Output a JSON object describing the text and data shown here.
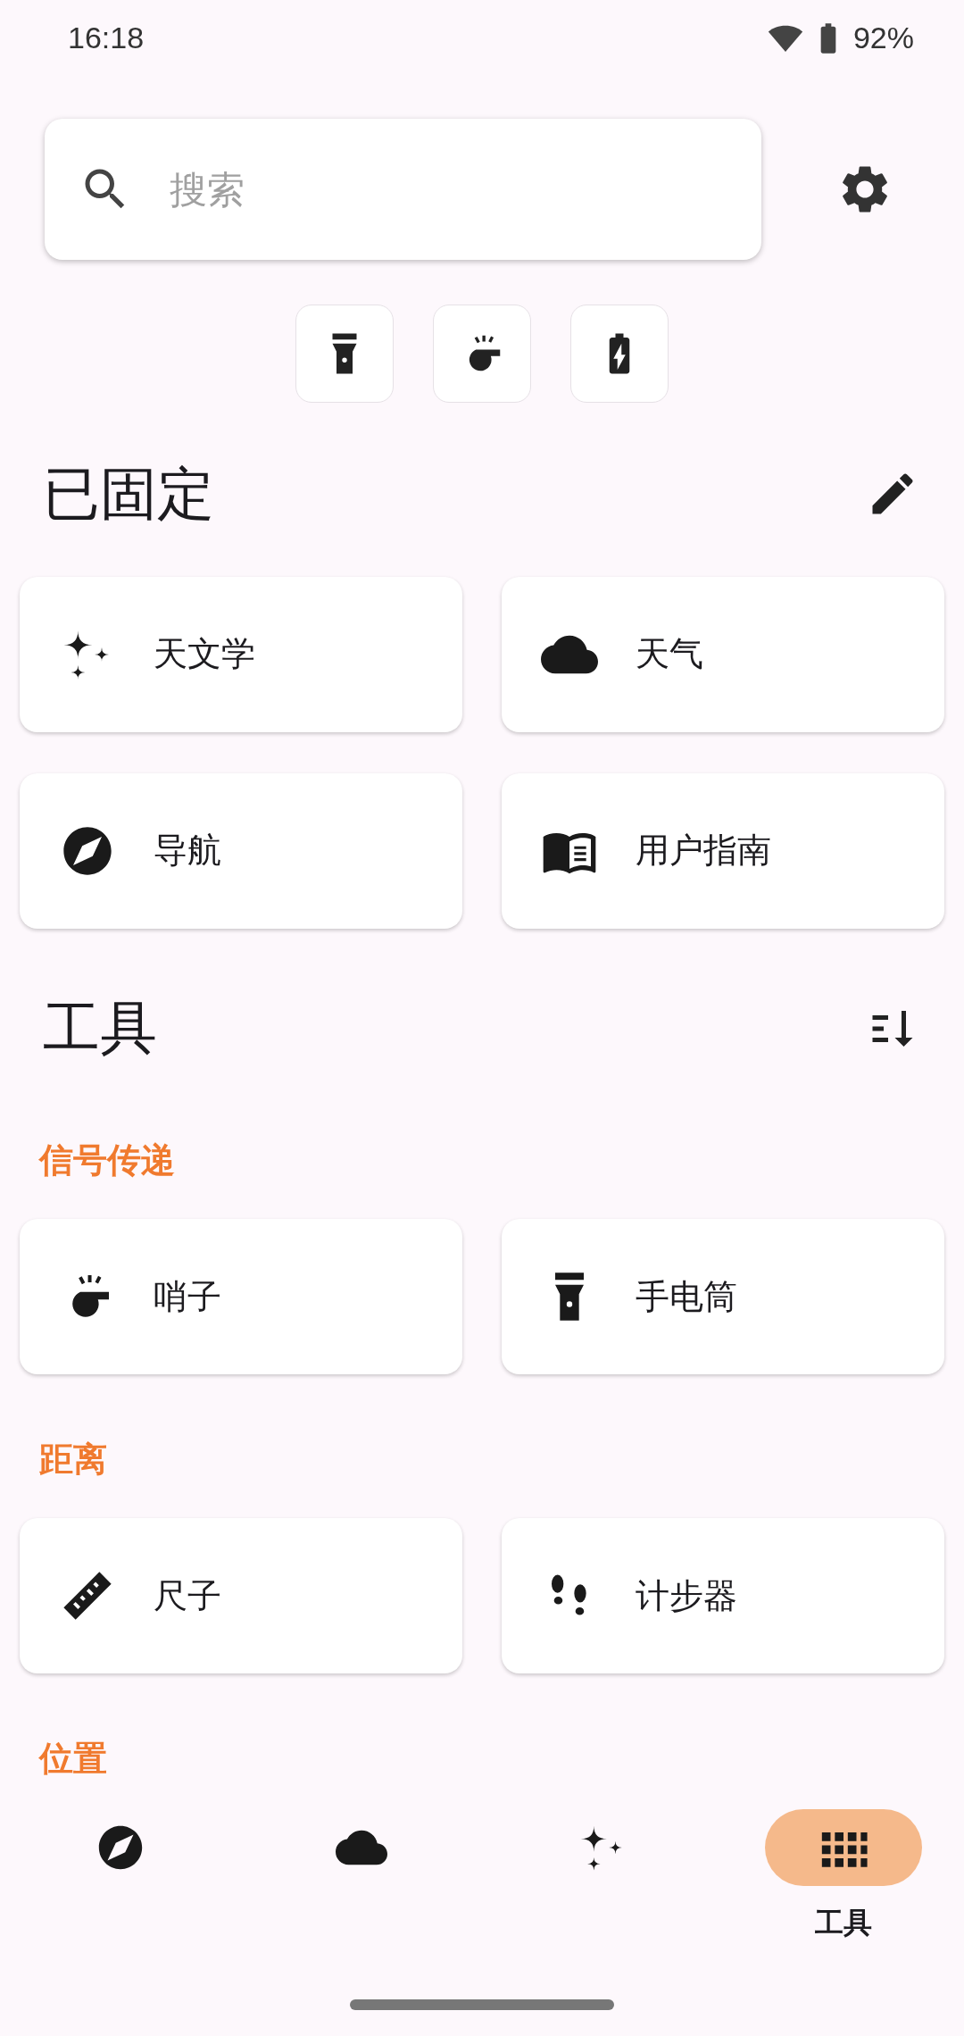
{
  "status_bar": {
    "time": "16:18",
    "battery": "92%"
  },
  "search": {
    "placeholder": "搜索"
  },
  "quick_tools": [
    {
      "kind": "flashlight"
    },
    {
      "kind": "whistle"
    },
    {
      "kind": "battery"
    }
  ],
  "pinned": {
    "title": "已固定",
    "items": [
      {
        "kind": "astronomy",
        "label": "天文学"
      },
      {
        "kind": "weather",
        "label": "天气"
      },
      {
        "kind": "navigation",
        "label": "导航"
      },
      {
        "kind": "guide",
        "label": "用户指南"
      }
    ]
  },
  "tools": {
    "title": "工具",
    "groups": [
      {
        "title": "信号传递",
        "items": [
          {
            "kind": "whistle",
            "label": "哨子"
          },
          {
            "kind": "flashlight",
            "label": "手电筒"
          }
        ]
      },
      {
        "title": "距离",
        "items": [
          {
            "kind": "ruler",
            "label": "尺子"
          },
          {
            "kind": "pedometer",
            "label": "计步器"
          }
        ]
      },
      {
        "title": "位置"
      }
    ]
  },
  "bottom_nav": [
    {
      "kind": "navigation",
      "selected": false
    },
    {
      "kind": "weather",
      "selected": false
    },
    {
      "kind": "astronomy",
      "selected": false
    },
    {
      "kind": "tools",
      "label": "工具",
      "selected": true
    }
  ]
}
